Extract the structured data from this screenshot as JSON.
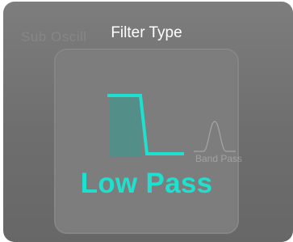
{
  "panel": {
    "ghost_label": "Sub Oscill",
    "title": "Filter Type"
  },
  "selector": {
    "selected": {
      "label": "Low Pass",
      "icon": "low-pass-curve-icon",
      "color": "#1ee0cf"
    },
    "next_option": {
      "label": "Band Pass",
      "icon": "band-pass-curve-icon"
    }
  }
}
